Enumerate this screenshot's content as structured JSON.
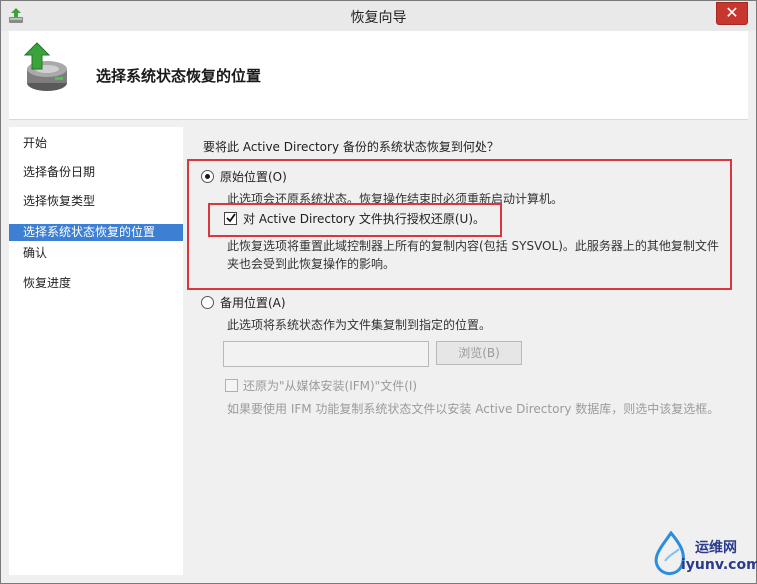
{
  "window": {
    "title": "恢复向导",
    "close_label": "✕"
  },
  "header": {
    "heading": "选择系统状态恢复的位置"
  },
  "sidebar": {
    "items": [
      {
        "label": "开始",
        "active": false
      },
      {
        "label": "选择备份日期",
        "active": false
      },
      {
        "label": "选择恢复类型",
        "active": false
      },
      {
        "label": "选择系统状态恢复的位置",
        "active": true
      },
      {
        "label": "确认",
        "active": false
      },
      {
        "label": "恢复进度",
        "active": false
      }
    ]
  },
  "main": {
    "question": "要将此 Active Directory 备份的系统状态恢复到何处？",
    "original": {
      "label": "原始位置(O)",
      "checked": true,
      "description": "此选项会还原系统状态。恢复操作结束时必须重新启动计算机。",
      "authoritative": {
        "label": "对 Active Directory 文件执行授权还原(U)。",
        "checked": true,
        "description_line1": "此恢复选项将重置此域控制器上所有的复制内容(包括 SYSVOL)。此服务器上的其他复制文件",
        "description_line2": "夹也会受到此恢复操作的影响。"
      }
    },
    "alternate": {
      "label": "备用位置(A)",
      "checked": false,
      "description": "此选项将系统状态作为文件集复制到指定的位置。",
      "path_value": "",
      "browse_label": "浏览(B)",
      "ifm": {
        "label": "还原为\"从媒体安装(IFM)\"文件(I)",
        "checked": false,
        "description": "如果要使用 IFM 功能复制系统状态文件以安装 Active Directory 数据库，则选中该复选框。"
      }
    }
  },
  "watermark": {
    "brand": "运维网",
    "domain": "iyunv.com"
  }
}
